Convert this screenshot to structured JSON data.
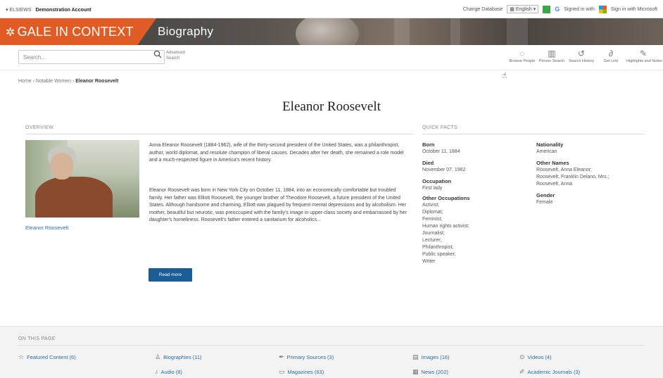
{
  "utility_bar": {
    "library_prefix": "▾ ELSIEWS",
    "library_name": "Demonstration Account",
    "change_database": "Change Database",
    "language_label": "English",
    "signed_in": "Signed in with",
    "sign_in_microsoft": "Sign in with Microsoft"
  },
  "banner": {
    "brand": "GALE IN CONTEXT",
    "product": "Biography"
  },
  "search": {
    "placeholder": "Search...",
    "advanced": "Advanced Search"
  },
  "tools": [
    {
      "icon": "lightbulb-icon",
      "label": "Browse People"
    },
    {
      "icon": "building-icon",
      "label": "Person Search"
    },
    {
      "icon": "history-icon",
      "label": "Search History"
    },
    {
      "icon": "link-icon",
      "label": "Get Link"
    },
    {
      "icon": "pencil-icon",
      "label": "Highlights and Notes"
    }
  ],
  "breadcrumb": {
    "items": [
      "Home",
      "Notable Women"
    ],
    "current": "Eleanor Roosevelt"
  },
  "title": "Eleanor Roosevelt",
  "overview": {
    "heading": "OVERVIEW",
    "photo_caption": "Eleanor Roosevelt",
    "paragraph1": "Anna Eleanor Roosevelt (1884-1962), wife of the thirty-second president of the United States, was a philanthropist, author, world diplomat, and resolute champion of liberal causes. Decades after her death, she remained a role model and a much-respected figure in America's recent history.",
    "paragraph2": "Eleanor Roosevelt was born in New York City on October 11, 1884, into an economically comfortable but troubled family. Her father was Elliott Roosevelt, the younger brother of Theodore Roosevelt, a future president of the United States. Although handsome and charming, Elliott was plagued by frequent mental depressions and by alcoholism. Her mother, beautiful but neurotic, was preoccupied with the family's image in upper-class society and embarrassed by her daughter's homeliness. Roosevelt's father entered a sanitarium for alcoholics...",
    "read_more": "Read more"
  },
  "quick_facts": {
    "heading": "QUICK FACTS",
    "born_label": "Born",
    "born_value": "October 11, 1884",
    "died_label": "Died",
    "died_value": "November 07, 1962",
    "occupation_label": "Occupation",
    "occupation_value": "First lady",
    "other_occupations_label": "Other Occupations",
    "other_occupations": [
      "Activist;",
      "Diplomat;",
      "Feminist;",
      "Human rights activist;",
      "Journalist;",
      "Lecturer;",
      "Philanthropist;",
      "Public speaker;",
      "Writer"
    ],
    "nationality_label": "Nationality",
    "nationality_value": "American",
    "other_names_label": "Other Names",
    "other_names": [
      "Roosevelt, Anna Eleanor;",
      "Roosevelt, Franklin Delano, Mrs.;",
      "Roosevelt, Anna"
    ],
    "gender_label": "Gender",
    "gender_value": "Female"
  },
  "on_this_page": {
    "heading": "ON THIS PAGE",
    "links": [
      {
        "icon": "star-icon",
        "label": "Featured Content (6)"
      },
      {
        "icon": "person-icon",
        "label": "Biographies (11)"
      },
      {
        "icon": "quill-icon",
        "label": "Primary Sources (3)"
      },
      {
        "icon": "image-icon",
        "label": "Images (16)"
      },
      {
        "icon": "play-icon",
        "label": "Videos (4)"
      },
      {
        "icon": "audio-icon",
        "label": "Audio (8)"
      },
      {
        "icon": "magazine-icon",
        "label": "Magazines (63)"
      },
      {
        "icon": "news-icon",
        "label": "News (202)"
      },
      {
        "icon": "journal-icon",
        "label": "Academic Journals (3)"
      }
    ]
  }
}
